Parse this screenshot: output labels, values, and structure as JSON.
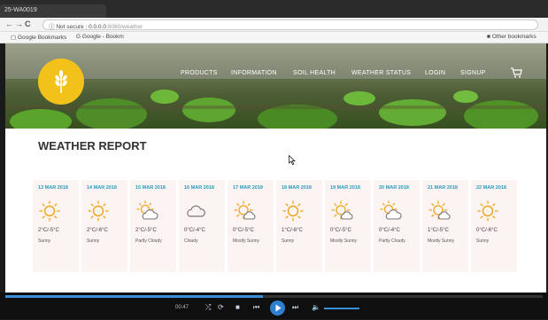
{
  "browser": {
    "tab_title": "25-WA0019",
    "not_secure_label": "Not secure",
    "url_host": "0.0.0.0",
    "url_path": ":8080/weather",
    "bookmarks": [
      {
        "label": "Google Bookmarks",
        "icon": "bookmark-icon"
      },
      {
        "label": "Google - Bookm",
        "icon": "google-icon"
      }
    ],
    "other_bookmarks": "Other bookmarks"
  },
  "nav": {
    "items": [
      "PRODUCTS",
      "INFORMATION",
      "SOIL HEALTH",
      "WEATHER STATUS",
      "LOGIN",
      "SIGNUP"
    ]
  },
  "page": {
    "title": "WEATHER REPORT"
  },
  "forecast": [
    {
      "date": "13 MAR 2018",
      "temp": "2°C/-5°C",
      "condition": "Sunny",
      "icon": "sunny-icon"
    },
    {
      "date": "14 MAR 2018",
      "temp": "2°C/-6°C",
      "condition": "Sunny",
      "icon": "sunny-icon"
    },
    {
      "date": "15 MAR 2018",
      "temp": "2°C/-5°C",
      "condition": "Partly Cloudy",
      "icon": "partly-cloudy-icon"
    },
    {
      "date": "16 MAR 2018",
      "temp": "0°C/-4°C",
      "condition": "Cloudy",
      "icon": "cloudy-icon"
    },
    {
      "date": "17 MAR 2018",
      "temp": "0°C/-5°C",
      "condition": "Mostly Sunny",
      "icon": "mostly-sunny-icon"
    },
    {
      "date": "18 MAR 2018",
      "temp": "1°C/-6°C",
      "condition": "Sunny",
      "icon": "sunny-icon"
    },
    {
      "date": "19 MAR 2018",
      "temp": "0°C/-5°C",
      "condition": "Mostly Sunny",
      "icon": "mostly-sunny-icon"
    },
    {
      "date": "20 MAR 2018",
      "temp": "0°C/-4°C",
      "condition": "Partly Cloudy",
      "icon": "partly-cloudy-icon"
    },
    {
      "date": "21 MAR 2018",
      "temp": "1°C/-5°C",
      "condition": "Mostly Sunny",
      "icon": "mostly-sunny-icon"
    },
    {
      "date": "22 MAR 2018",
      "temp": "0°C/-6°C",
      "condition": "Sunny",
      "icon": "sunny-icon"
    }
  ],
  "player": {
    "time": "00:47",
    "progress": 0.48
  },
  "colors": {
    "accent_date": "#2a9bbf",
    "logo": "#f2c21b",
    "player_accent": "#3b8fd6"
  }
}
